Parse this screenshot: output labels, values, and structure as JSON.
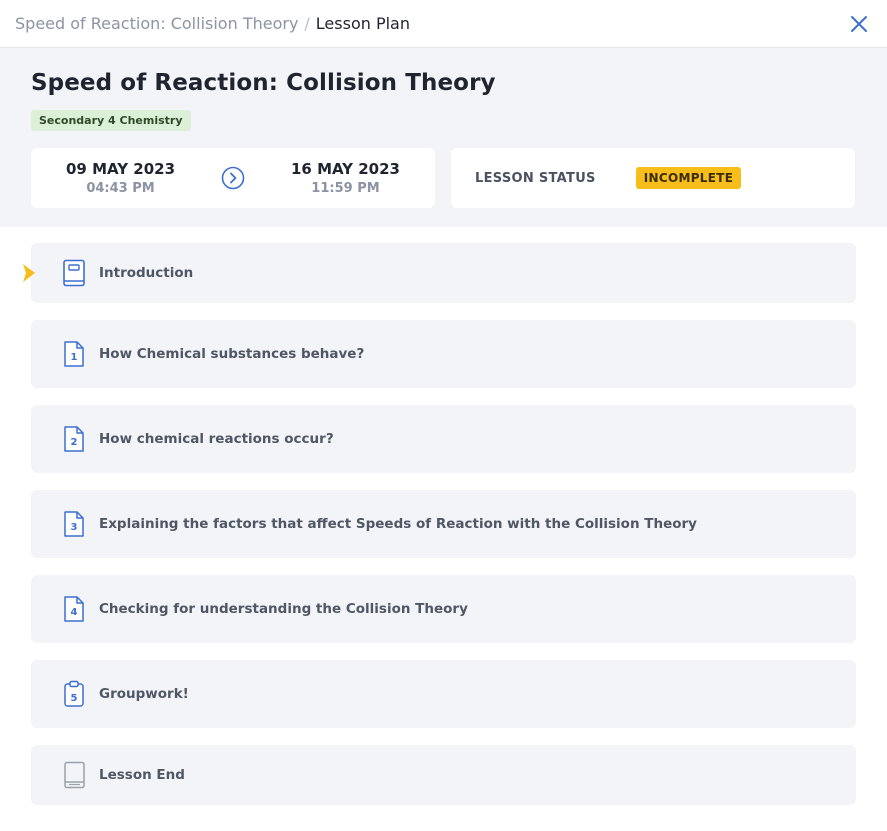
{
  "breadcrumb": {
    "parent": "Speed of Reaction: Collision Theory",
    "separator": "/",
    "current": "Lesson Plan"
  },
  "lesson": {
    "title": "Speed of Reaction: Collision Theory",
    "tag": "Secondary 4 Chemistry",
    "start": {
      "date": "09 MAY 2023",
      "time": "04:43 PM"
    },
    "end": {
      "date": "16 MAY 2023",
      "time": "11:59 PM"
    },
    "status_label": "LESSON STATUS",
    "status_value": "INCOMPLETE"
  },
  "items": [
    {
      "label": "Introduction",
      "icon": "book-icon",
      "number": ""
    },
    {
      "label": "How Chemical substances behave?",
      "icon": "document-icon",
      "number": "1"
    },
    {
      "label": "How chemical reactions occur?",
      "icon": "document-icon",
      "number": "2"
    },
    {
      "label": "Explaining the factors that affect Speeds of Reaction with the Collision Theory",
      "icon": "document-icon",
      "number": "3"
    },
    {
      "label": "Checking for understanding the Collision Theory",
      "icon": "document-icon",
      "number": "4"
    },
    {
      "label": "Groupwork!",
      "icon": "clipboard-icon",
      "number": "5"
    },
    {
      "label": "Lesson End",
      "icon": "closed-book-icon",
      "number": ""
    }
  ],
  "colors": {
    "accent_blue": "#3d6fd1",
    "status_badge": "#f7bd1b",
    "tag_bg": "#dcefd7",
    "current_marker": "#f7bd1b"
  }
}
